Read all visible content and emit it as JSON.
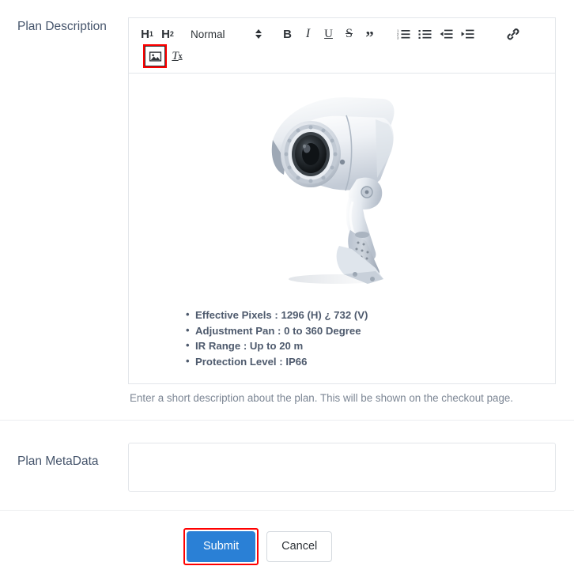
{
  "form": {
    "description_label": "Plan Description",
    "metadata_label": "Plan MetaData",
    "help_text": "Enter a short description about the plan. This will be shown on the checkout page.",
    "metadata_value": "",
    "metadata_placeholder": ""
  },
  "toolbar": {
    "h1_label": "H",
    "h1_sub": "1",
    "h2_label": "H",
    "h2_sub": "2",
    "format_value": "Normal",
    "bold_label": "B",
    "italic_label": "I",
    "underline_label": "U",
    "strike_label": "S",
    "quote_label": "”",
    "clear_label": "T",
    "clear_sub": "x",
    "ordered_list_name": "ordered-list",
    "bullet_list_name": "bullet-list",
    "outdent_name": "outdent",
    "indent_name": "indent",
    "link_name": "link",
    "image_name": "image"
  },
  "content": {
    "image_alt": "white bullet CCTV security camera",
    "specs": [
      "Effective Pixels : 1296 (H) ¿ 732 (V)",
      "Adjustment Pan : 0 to 360 Degree",
      "IR Range : Up to 20 m",
      "Protection Level : IP66"
    ]
  },
  "actions": {
    "submit_label": "Submit",
    "cancel_label": "Cancel"
  },
  "colors": {
    "primary": "#2a80d6",
    "highlight": "#ff0000",
    "label_text": "#45546b",
    "help_text": "#7c8694",
    "border": "#e3e6ea"
  }
}
